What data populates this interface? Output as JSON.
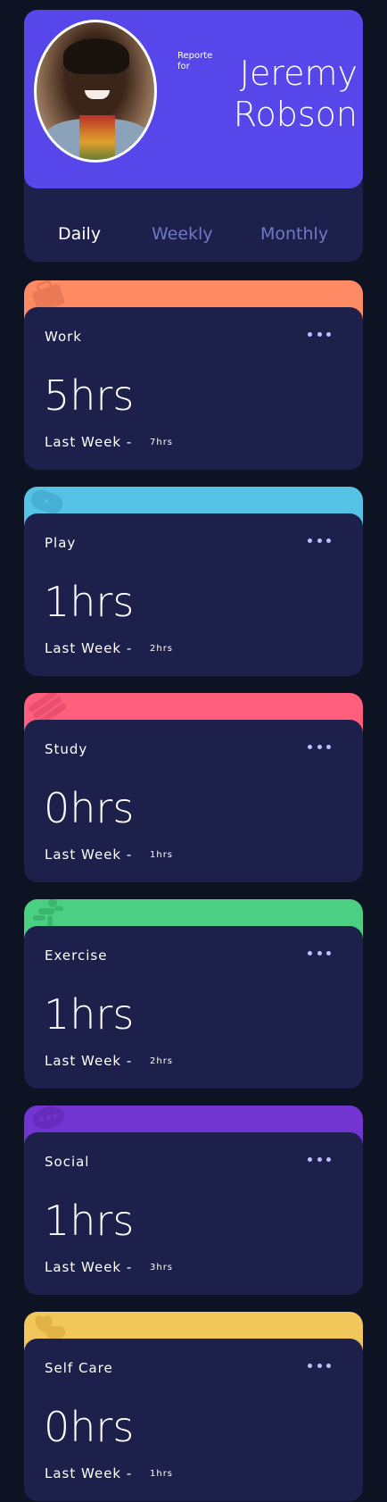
{
  "profile": {
    "reported_for": "Reporte for",
    "name": "Jeremy Robson",
    "accent_color": "#5747ea"
  },
  "tabs": [
    {
      "label": "Daily",
      "active": true
    },
    {
      "label": "Weekly",
      "active": false
    },
    {
      "label": "Monthly",
      "active": false
    }
  ],
  "activities": [
    {
      "title": "Work",
      "hours": "5hrs",
      "last_week_label": "Last Week -",
      "last_week_value": "7hrs",
      "color": "#ff8b64",
      "icon": "briefcase-icon"
    },
    {
      "title": "Play",
      "hours": "1hrs",
      "last_week_label": "Last Week -",
      "last_week_value": "2hrs",
      "color": "#55c2e6",
      "icon": "gamepad-icon"
    },
    {
      "title": "Study",
      "hours": "0hrs",
      "last_week_label": "Last Week -",
      "last_week_value": "1hrs",
      "color": "#ff5e7d",
      "icon": "books-icon"
    },
    {
      "title": "Exercise",
      "hours": "1hrs",
      "last_week_label": "Last Week -",
      "last_week_value": "2hrs",
      "color": "#4bcf82",
      "icon": "runner-icon"
    },
    {
      "title": "Social",
      "hours": "1hrs",
      "last_week_label": "Last Week -",
      "last_week_value": "3hrs",
      "color": "#7335d2",
      "icon": "speech-bubbles-icon"
    },
    {
      "title": "Self Care",
      "hours": "0hrs",
      "last_week_label": "Last Week -",
      "last_week_value": "1hrs",
      "color": "#f1c75b",
      "icon": "heart-hand-icon"
    }
  ]
}
